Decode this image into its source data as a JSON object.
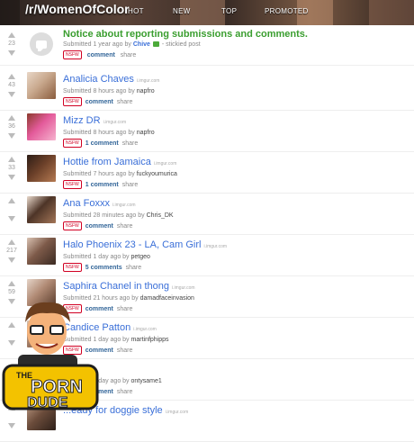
{
  "header": {
    "subreddit": "/r/WomenOfColor",
    "tabs": [
      "HOT",
      "NEW",
      "TOP",
      "PROMOTED"
    ]
  },
  "sticky": {
    "score": "23",
    "title": "Notice about reporting submissions and comments.",
    "submitted": "Submitted 1 year ago",
    "by": "by",
    "user": "Chive",
    "tag": "stickied post",
    "nsfw": "NSFW",
    "comments": "comment",
    "share": "share"
  },
  "posts": [
    {
      "score": "43",
      "title": "Analicia Chaves",
      "domain": "i.imgur.com",
      "submitted": "Submitted 8 hours ago by",
      "user": "napfro",
      "nsfw": "NSFW",
      "comments": "comment",
      "share": "share",
      "thumb": [
        "#c9a98e",
        "#8a5c3d",
        "#e8d6c6"
      ]
    },
    {
      "score": "36",
      "title": "Mizz DR",
      "domain": "i.imgur.com",
      "submitted": "Submitted 8 hours ago by",
      "user": "napfro",
      "nsfw": "NSFW",
      "comments": "1 comment",
      "share": "share",
      "thumb": [
        "#e35a9a",
        "#f6b3cf",
        "#8c3a2c"
      ]
    },
    {
      "score": "33",
      "title": "Hottie from Jamaica",
      "domain": "i.imgur.com",
      "submitted": "Submitted 7 hours ago by",
      "user": "fuckyoumurica",
      "nsfw": "NSFW",
      "comments": "1 comment",
      "share": "share",
      "thumb": [
        "#6a3f28",
        "#b57a52",
        "#2c1d16"
      ]
    },
    {
      "score": "",
      "title": "Ana Foxxx",
      "domain": "i.imgur.com",
      "submitted": "Submitted 28 minutes ago by",
      "user": "Chris_DK",
      "nsfw": "NSFW",
      "comments": "comment",
      "share": "share",
      "thumb": [
        "#4d3427",
        "#a37658",
        "#e9d9cc"
      ]
    },
    {
      "score": "217",
      "title": "Halo Phoenix 23 - LA, Cam Girl",
      "domain": "i.imgur.com",
      "submitted": "Submitted 1 day ago by",
      "user": "petgeo",
      "nsfw": "NSFW",
      "comments": "5 comments",
      "share": "share",
      "thumb": [
        "#7d5a49",
        "#3b2a22",
        "#d9c2b2"
      ]
    },
    {
      "score": "59",
      "title": "Saphira Chanel in thong",
      "domain": "i.imgur.com",
      "submitted": "Submitted 21 hours ago by",
      "user": "damadfaceinvasion",
      "nsfw": "NSFW",
      "comments": "comment",
      "share": "share",
      "thumb": [
        "#b08a74",
        "#5b3d2d",
        "#e5d4c8"
      ]
    },
    {
      "score": "",
      "title": "Candice Patton",
      "domain": "i.imgur.com",
      "submitted": "Submitted 1 day ago by",
      "user": "martinfphipps",
      "nsfw": "NSFW",
      "comments": "comment",
      "share": "share",
      "thumb": [
        "#a27b63",
        "#4a3226",
        "#d7c1b0"
      ]
    },
    {
      "score": "",
      "title": "...s",
      "domain": "",
      "submitted": "Submitted 1 day ago by",
      "user": "ontysame1",
      "nsfw": "NSFW",
      "comments": "comment",
      "share": "share",
      "thumb": [
        "#8f6a55",
        "#3d2a20",
        "#cdb7a6"
      ]
    },
    {
      "score": "",
      "title": "...eady for doggie style",
      "domain": "i.imgur.com",
      "submitted": "",
      "user": "",
      "nsfw": "",
      "comments": "",
      "share": "",
      "thumb": [
        "#6b4c3b",
        "#2e2019",
        "#b89680"
      ]
    }
  ],
  "watermark": {
    "line1": "THE",
    "line2": "PORN",
    "line3": "DUDE"
  }
}
